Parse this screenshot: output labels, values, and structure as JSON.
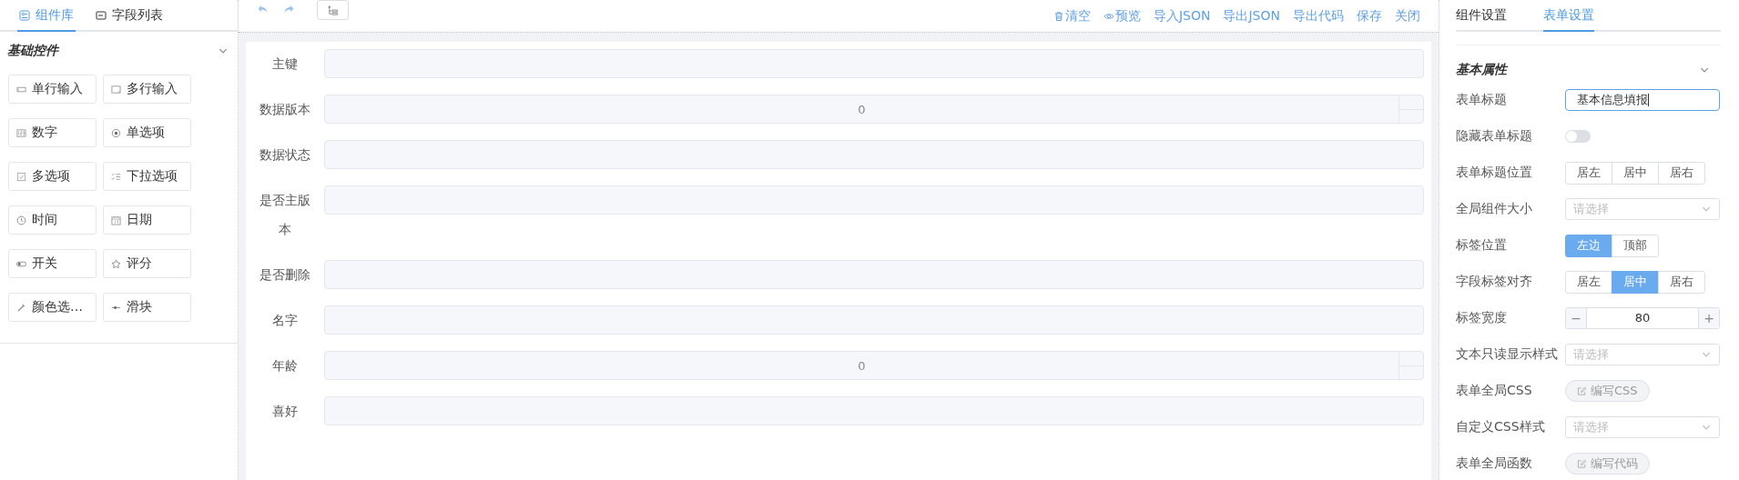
{
  "left_tabs": [
    {
      "label": "组件库",
      "kind": "library",
      "selected": true
    },
    {
      "label": "字段列表",
      "kind": "fields",
      "selected": false
    }
  ],
  "palette": {
    "title": "基础控件",
    "expanded": true,
    "items": [
      {
        "label": "单行输入",
        "kind": "input"
      },
      {
        "label": "多行输入",
        "kind": "textarea"
      },
      {
        "label": "数字",
        "kind": "number"
      },
      {
        "label": "单选项",
        "kind": "radio"
      },
      {
        "label": "多选项",
        "kind": "checkbox"
      },
      {
        "label": "下拉选项",
        "kind": "select"
      },
      {
        "label": "时间",
        "kind": "time"
      },
      {
        "label": "日期",
        "kind": "date"
      },
      {
        "label": "开关",
        "kind": "switch"
      },
      {
        "label": "评分",
        "kind": "rate"
      },
      {
        "label": "颜色选…",
        "kind": "color"
      },
      {
        "label": "滑块",
        "kind": "slider"
      }
    ]
  },
  "toolbar": {
    "actions": [
      {
        "label": "清空",
        "kind": "clear"
      },
      {
        "label": "预览",
        "kind": "preview"
      },
      {
        "label": "导入JSON",
        "kind": "plain"
      },
      {
        "label": "导出JSON",
        "kind": "plain"
      },
      {
        "label": "导出代码",
        "kind": "plain"
      },
      {
        "label": "保存",
        "kind": "plain"
      },
      {
        "label": "关闭",
        "kind": "plain"
      }
    ]
  },
  "form": {
    "fields": [
      {
        "label": "主键",
        "kind": "text"
      },
      {
        "label": "数据版本",
        "kind": "number",
        "value": "0"
      },
      {
        "label": "数据状态",
        "kind": "text"
      },
      {
        "label": "是否主版本",
        "kind": "text"
      },
      {
        "label": "是否删除",
        "kind": "text"
      },
      {
        "label": "名字",
        "kind": "text"
      },
      {
        "label": "年龄",
        "kind": "number",
        "value": "0"
      },
      {
        "label": "喜好",
        "kind": "text"
      }
    ]
  },
  "right_tabs": [
    {
      "label": "组件设置",
      "selected": false
    },
    {
      "label": "表单设置",
      "selected": true
    }
  ],
  "settings": {
    "title": "基本属性",
    "expanded": true,
    "rows": [
      {
        "label": "表单标题",
        "kind": "input",
        "value": "基本信息填报"
      },
      {
        "label": "隐藏表单标题",
        "kind": "switch",
        "on": false
      },
      {
        "label": "表单标题位置",
        "kind": "segmented",
        "options": [
          {
            "label": "居左",
            "selected": false
          },
          {
            "label": "居中",
            "selected": false
          },
          {
            "label": "居右",
            "selected": false
          }
        ]
      },
      {
        "label": "全局组件大小",
        "kind": "select",
        "placeholder": "请选择"
      },
      {
        "label": "标签位置",
        "kind": "segmented",
        "options": [
          {
            "label": "左边",
            "selected": true
          },
          {
            "label": "顶部",
            "selected": false
          }
        ]
      },
      {
        "label": "字段标签对齐",
        "kind": "segmented",
        "options": [
          {
            "label": "居左",
            "selected": false
          },
          {
            "label": "居中",
            "selected": true
          },
          {
            "label": "居右",
            "selected": false
          }
        ]
      },
      {
        "label": "标签宽度",
        "kind": "stepper",
        "value": "80",
        "minus": "−",
        "plus": "+"
      },
      {
        "label": "文本只读显示样式",
        "kind": "select",
        "placeholder": "请选择"
      },
      {
        "label": "表单全局CSS",
        "kind": "action",
        "button": "编写CSS"
      },
      {
        "label": "自定义CSS样式",
        "kind": "select",
        "placeholder": "请选择"
      },
      {
        "label": "表单全局函数",
        "kind": "action",
        "button": "编写代码"
      }
    ]
  }
}
